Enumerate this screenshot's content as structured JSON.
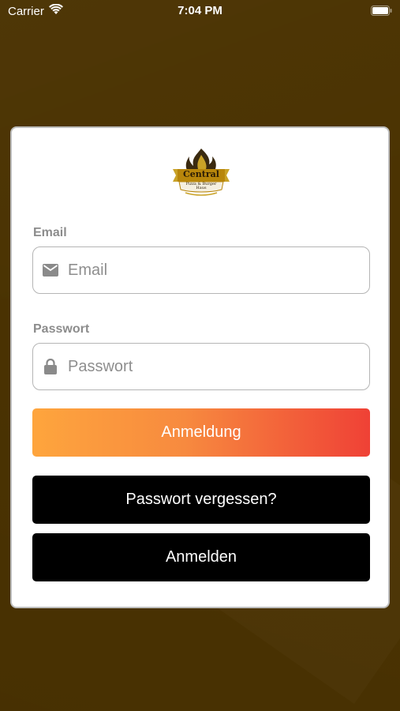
{
  "status_bar": {
    "carrier": "Carrier",
    "time": "7:04 PM"
  },
  "logo": {
    "brand": "Central",
    "subtitle_line1": "Pizza & Burger",
    "subtitle_line2": "Haus",
    "icon": "flame-logo-icon"
  },
  "form": {
    "email": {
      "label": "Email",
      "placeholder": "Email",
      "value": "",
      "icon": "mail-icon"
    },
    "password": {
      "label": "Passwort",
      "placeholder": "Passwort",
      "value": "",
      "icon": "lock-icon"
    }
  },
  "buttons": {
    "login": "Anmeldung",
    "forgot_password": "Passwort vergessen?",
    "register": "Anmelden"
  },
  "colors": {
    "background": "#4b3302",
    "login_gradient_start": "#fea53d",
    "login_gradient_end": "#ef4136",
    "secondary_button": "#000000",
    "logo_gold": "#b8860b"
  }
}
